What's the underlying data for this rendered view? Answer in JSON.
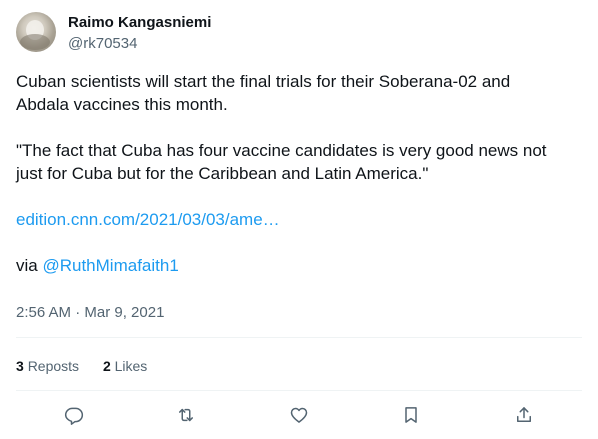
{
  "author": {
    "name": "Raimo Kangasniemi",
    "handle": "@rk70534"
  },
  "tweet": {
    "line1": "Cuban scientists will start the final trials for their Soberana-02 and",
    "line2": "Abdala vaccines this month.",
    "line3": "\"The fact that Cuba has four vaccine candidates is very good news not",
    "line4": "just for Cuba but for the Caribbean and Latin America.\"",
    "link": "edition.cnn.com/2021/03/03/ame…",
    "via_prefix": "via ",
    "mention": "@RuthMimafaith1",
    "timestamp": "2:56 AM · Mar 9, 2021"
  },
  "stats": {
    "reposts_count": "3",
    "reposts_label": "Reposts",
    "likes_count": "2",
    "likes_label": "Likes"
  },
  "icons": {
    "reply": "reply-icon",
    "repost": "repost-icon",
    "like": "like-icon",
    "bookmark": "bookmark-icon",
    "share": "share-icon"
  },
  "colors": {
    "link": "#1d9bf0",
    "secondary_text": "#536471",
    "icon": "#536471",
    "divider": "#eff3f4"
  }
}
